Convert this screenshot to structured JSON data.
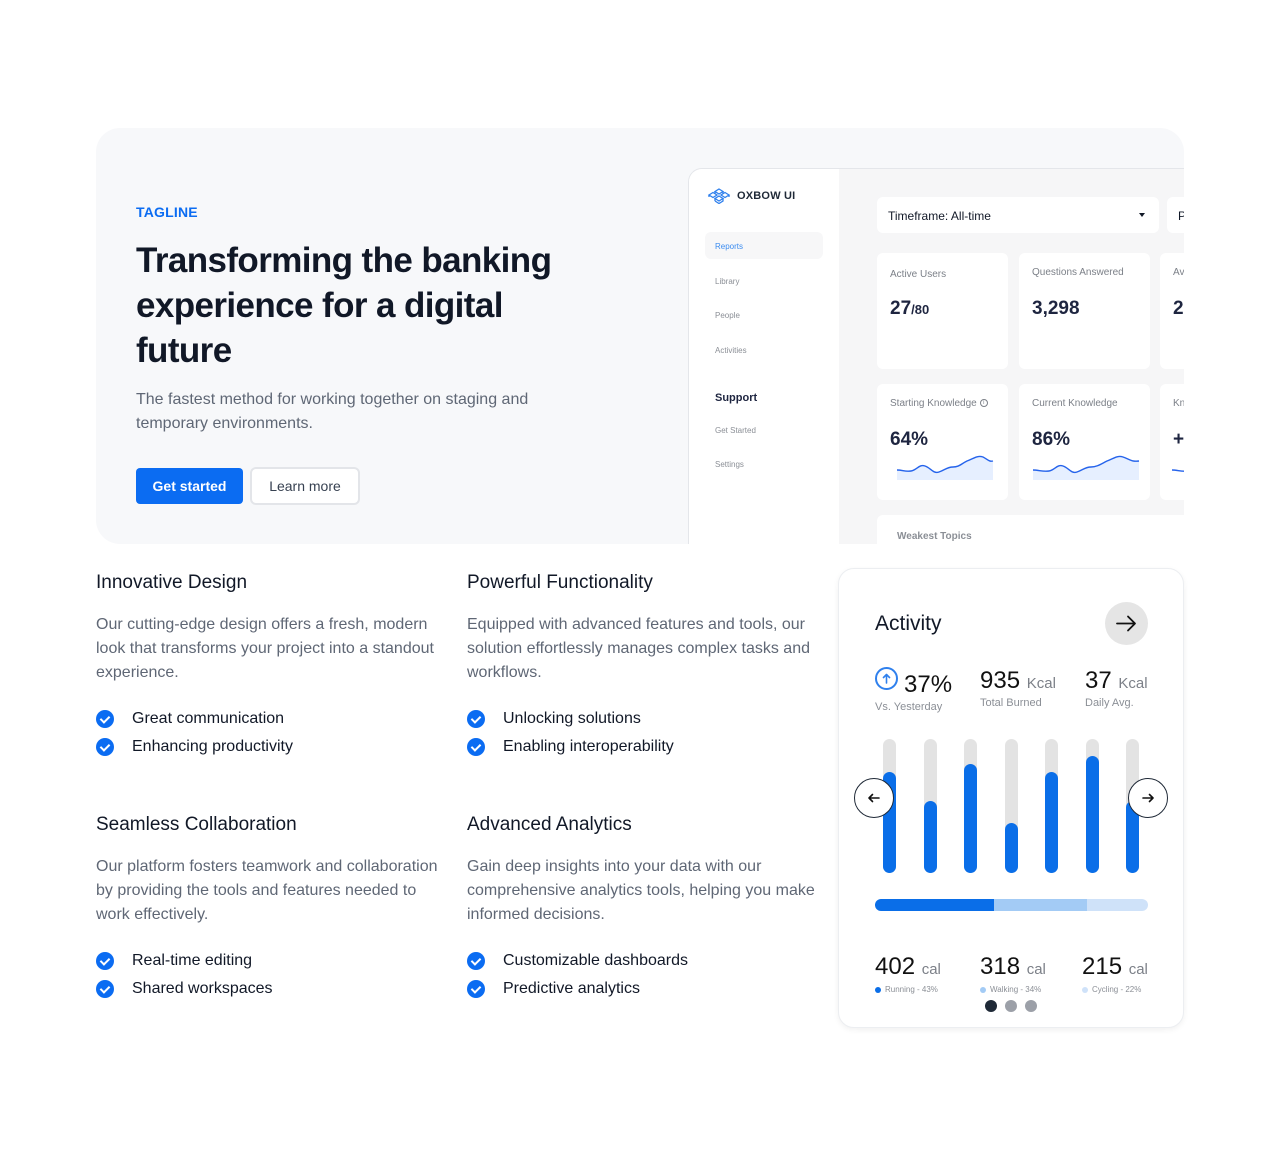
{
  "hero": {
    "tagline": "TAGLINE",
    "title": "Transforming the banking experience for a digital future",
    "subtitle": "The fastest method for working together on staging and temporary environments.",
    "primary_button": "Get started",
    "secondary_button": "Learn more",
    "accent_color": "#0b6cf2"
  },
  "dashboard": {
    "brand": "OXBOW UI",
    "nav": [
      {
        "label": "Reports",
        "active": true
      },
      {
        "label": "Library",
        "active": false
      },
      {
        "label": "People",
        "active": false
      },
      {
        "label": "Activities",
        "active": false
      }
    ],
    "support_heading": "Support",
    "support_nav": [
      {
        "label": "Get Started"
      },
      {
        "label": "Settings"
      }
    ],
    "timeframe_dropdown": "Timeframe: All-time",
    "second_dropdown_partial": "P",
    "stats": [
      {
        "label": "Active Users",
        "value": "27",
        "suffix": "/80"
      },
      {
        "label": "Questions Answered",
        "value": "3,298"
      },
      {
        "label": "Av",
        "value": "2"
      }
    ],
    "knowledge": [
      {
        "label": "Starting Knowledge",
        "value": "64%",
        "has_info_icon": true
      },
      {
        "label": "Current Knowledge",
        "value": "86%"
      },
      {
        "label": "Kn",
        "value": "+"
      }
    ],
    "weakest_topics_label": "Weakest Topics"
  },
  "features": [
    {
      "title": "Innovative Design",
      "description": "Our cutting-edge design offers a fresh, modern look that transforms your project into a standout experience.",
      "items": [
        "Great communication",
        "Enhancing productivity"
      ]
    },
    {
      "title": "Powerful Functionality",
      "description": "Equipped with advanced features and tools, our solution effortlessly manages complex tasks and workflows.",
      "items": [
        "Unlocking solutions",
        "Enabling interoperability"
      ]
    },
    {
      "title": "Seamless Collaboration",
      "description": "Our platform fosters teamwork and collaboration by providing the tools and features needed to work effectively.",
      "items": [
        "Real-time editing",
        "Shared workspaces"
      ]
    },
    {
      "title": "Advanced Analytics",
      "description": "Gain deep insights into your data with our comprehensive analytics tools, helping you make informed decisions.",
      "items": [
        "Customizable dashboards",
        "Predictive analytics"
      ]
    }
  ],
  "activity": {
    "title": "Activity",
    "stats": [
      {
        "value": "37%",
        "unit": "",
        "label": "Vs. Yesterday",
        "icon": "arrow-up-circle-icon"
      },
      {
        "value": "935",
        "unit": "Kcal",
        "label": "Total Burned"
      },
      {
        "value": "37",
        "unit": "Kcal",
        "label": "Daily Avg."
      }
    ],
    "bar_fill_fractions": [
      0.75,
      0.54,
      0.81,
      0.37,
      0.75,
      0.87,
      0.54
    ],
    "breakdown": [
      {
        "value": "402",
        "unit": "cal",
        "label": "Running - 43%",
        "percent": 43,
        "color": "#0a6ee8"
      },
      {
        "value": "318",
        "unit": "cal",
        "label": "Walking - 34%",
        "percent": 34,
        "color": "#a3cbf5"
      },
      {
        "value": "215",
        "unit": "cal",
        "label": "Cycling - 22%",
        "percent": 22,
        "color": "#cfe2f9"
      }
    ],
    "pager": {
      "total": 3,
      "active": 0
    }
  }
}
